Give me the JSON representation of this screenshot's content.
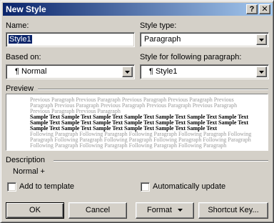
{
  "window": {
    "title": "New Style"
  },
  "titlebar": {
    "help_glyph": "?",
    "close_glyph": "✕"
  },
  "name": {
    "label": "Name:",
    "value": "Style1"
  },
  "style_type": {
    "label": "Style type:",
    "value": "Paragraph"
  },
  "based_on": {
    "label": "Based on:",
    "value": "¶ Normal"
  },
  "following": {
    "label": "Style for following paragraph:",
    "value": "¶ Style1"
  },
  "preview": {
    "label": "Preview",
    "previous_text": "Previous Paragraph Previous Paragraph Previous Paragraph Previous Paragraph Previous Paragraph Previous Paragraph Previous Paragraph Previous Paragraph Previous Paragraph Previous Paragraph Previous Paragraph",
    "sample_text": "Sample Text Sample Text Sample Text Sample Text Sample Text Sample Text Sample Text Sample Text Sample Text Sample Text Sample Text Sample Text Sample Text Sample Text Sample Text Sample Text Sample Text Sample Text Sample Text Sample Text",
    "following_text": "Following Paragraph Following Paragraph Following Paragraph Following Paragraph Following Paragraph Following Paragraph Following Paragraph Following Paragraph Following Paragraph Following Paragraph Following Paragraph Following Paragraph Following Paragraph"
  },
  "description": {
    "label": "Description",
    "value": "Normal +"
  },
  "add_to_template": {
    "label": "Add to template",
    "checked": false
  },
  "auto_update": {
    "label": "Automatically update",
    "checked": false
  },
  "buttons": {
    "ok": "OK",
    "cancel": "Cancel",
    "format": "Format",
    "shortcut": "Shortcut Key..."
  }
}
